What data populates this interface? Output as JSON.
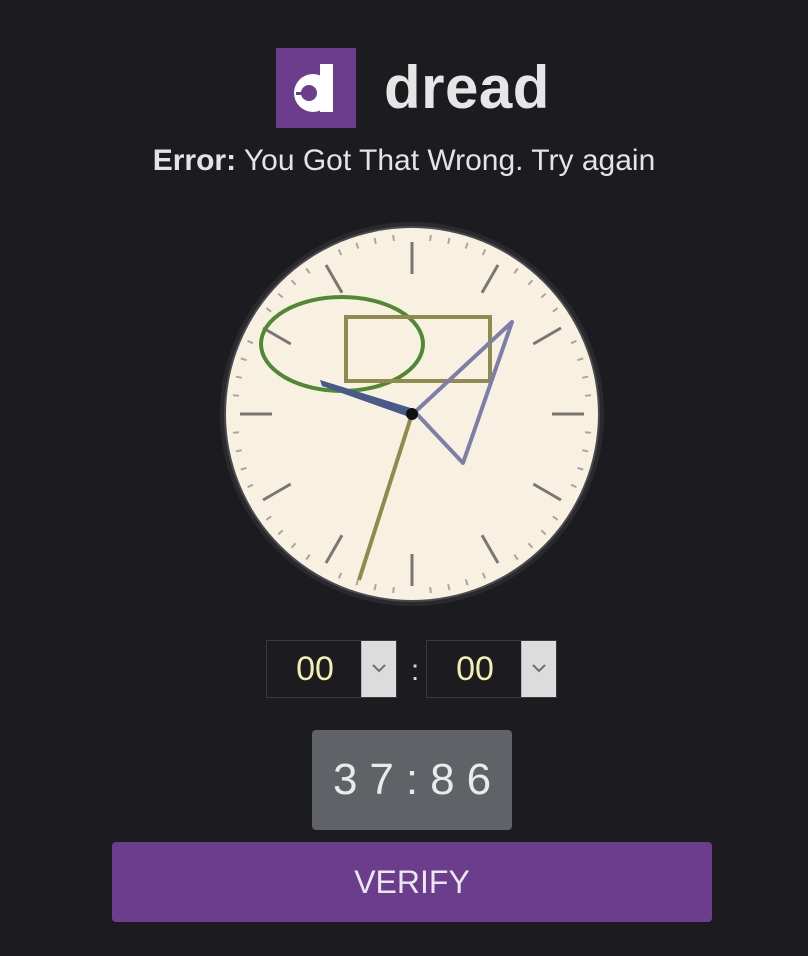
{
  "brand": {
    "name": "dread",
    "logo_letter": "d",
    "accent_color": "#6b3d8c"
  },
  "message": {
    "label": "Error:",
    "text": "You Got That Wrong. Try again"
  },
  "clock": {
    "face_color": "#f8f1e2",
    "captcha_shapes": [
      "ellipse",
      "rectangle",
      "triangle"
    ],
    "hands": {
      "hour_color": "#485a8a",
      "minute_color": "#8f8a4e"
    }
  },
  "time_inputs": {
    "hour": {
      "value": "00"
    },
    "separator": ":",
    "minute": {
      "value": "00"
    }
  },
  "captcha_code": "37:86",
  "verify_button": {
    "label": "VERIFY"
  }
}
